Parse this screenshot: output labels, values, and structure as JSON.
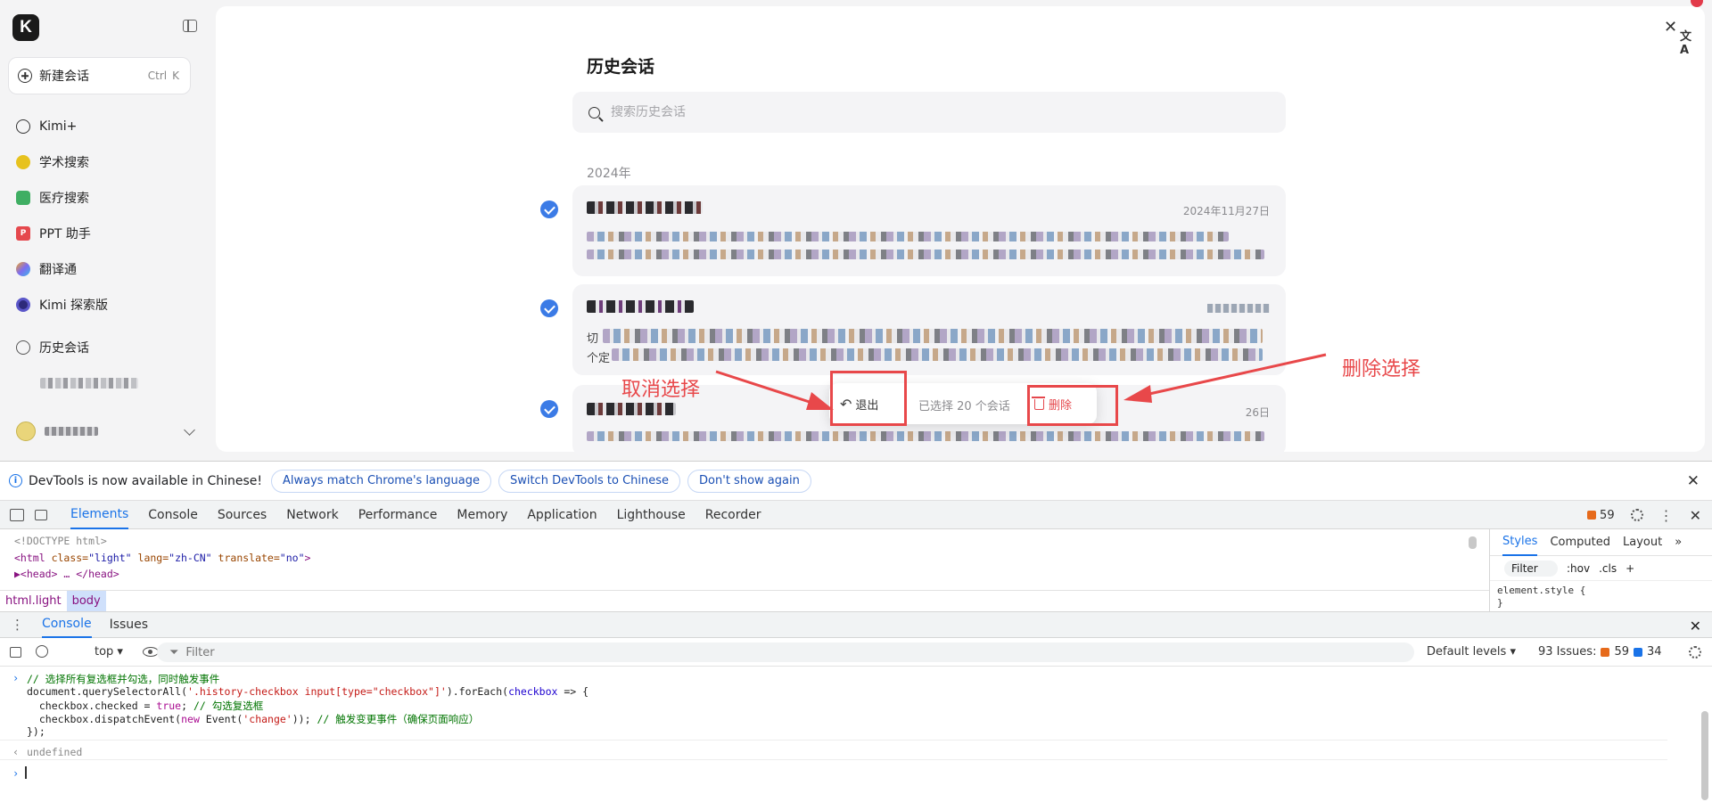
{
  "sidebar": {
    "logo_letter": "K",
    "new_chat": {
      "label": "新建会话",
      "shortcut_ctrl": "Ctrl",
      "shortcut_key": "K"
    },
    "items": [
      {
        "label": "Kimi+",
        "color": "#333333"
      },
      {
        "label": "学术搜索",
        "color": "#e7c21e"
      },
      {
        "label": "医疗搜索",
        "color": "#3fae63"
      },
      {
        "label": "PPT 助手",
        "color": "#e5484d"
      },
      {
        "label": "翻译通",
        "color": "#7d6cf0"
      },
      {
        "label": "Kimi 探索版",
        "color": "#2d2a7a"
      },
      {
        "label": "历史会话",
        "color": "#555555"
      }
    ]
  },
  "main": {
    "title": "历史会话",
    "search_placeholder": "搜索历史会话",
    "year_label": "2024年",
    "conversations": [
      {
        "date": "2024年11月27日"
      },
      {
        "date": "",
        "snippet_prefix": "切",
        "snippet_line2_prefix": "个定"
      },
      {
        "date": "26日"
      }
    ],
    "action_bar": {
      "exit_label": "退出",
      "selected_text": "已选择 20 个会话",
      "delete_label": "删除"
    }
  },
  "annotations": {
    "cancel_select": "取消选择",
    "delete_select": "删除选择",
    "color": "#e8484a"
  },
  "devtools": {
    "info_message": "DevTools is now available in Chinese!",
    "info_buttons": [
      "Always match Chrome's language",
      "Switch DevTools to Chinese",
      "Don't show again"
    ],
    "tabs": [
      "Elements",
      "Console",
      "Sources",
      "Network",
      "Performance",
      "Memory",
      "Application",
      "Lighthouse",
      "Recorder"
    ],
    "active_tab": "Elements",
    "issues_badge": "59",
    "elements_code": {
      "doctype": "<!DOCTYPE html>",
      "html_open_tag": "<html",
      "html_attr1_name": "class=",
      "html_attr1_value": "\"light\"",
      "html_attr2_name": "lang=",
      "html_attr2_value": "\"zh-CN\"",
      "html_attr3_name": "translate=",
      "html_attr3_value": "\"no\"",
      "html_close_bracket": ">",
      "head_line": "▶<head> … </head>"
    },
    "breadcrumbs": [
      "html.light",
      "body"
    ],
    "styles_tabs": [
      "Styles",
      "Computed",
      "Layout"
    ],
    "styles_filter": "Filter",
    "styles_hov": ":hov",
    "styles_cls": ".cls",
    "element_style_line1": "element.style {",
    "element_style_line2": "}",
    "console_tabs": [
      "Console",
      "Issues"
    ],
    "console_context": "top ▾",
    "console_filter_placeholder": "Filter",
    "default_levels": "Default levels ▾",
    "issues_summary_label": "93 Issues:",
    "issues_orange": "59",
    "issues_blue": "34",
    "console_lines": {
      "line1": "// 选择所有复选框并勾选，同时触发事件",
      "line2a": "document.querySelectorAll(",
      "line2b": "'.history-checkbox input[type=\"checkbox\"]'",
      "line2c": ").forEach(",
      "line2d": "checkbox",
      "line2e": " => {",
      "line3a": "  checkbox.checked = ",
      "line3b": "true",
      "line3c": "; ",
      "line3d": "// 勾选复选框",
      "line4a": "  checkbox.dispatchEvent(",
      "line4b": "new",
      "line4c": " Event(",
      "line4d": "'change'",
      "line4e": ")); ",
      "line4f": "// 触发变更事件（确保页面响应）",
      "line5": "});",
      "result": "undefined"
    }
  }
}
